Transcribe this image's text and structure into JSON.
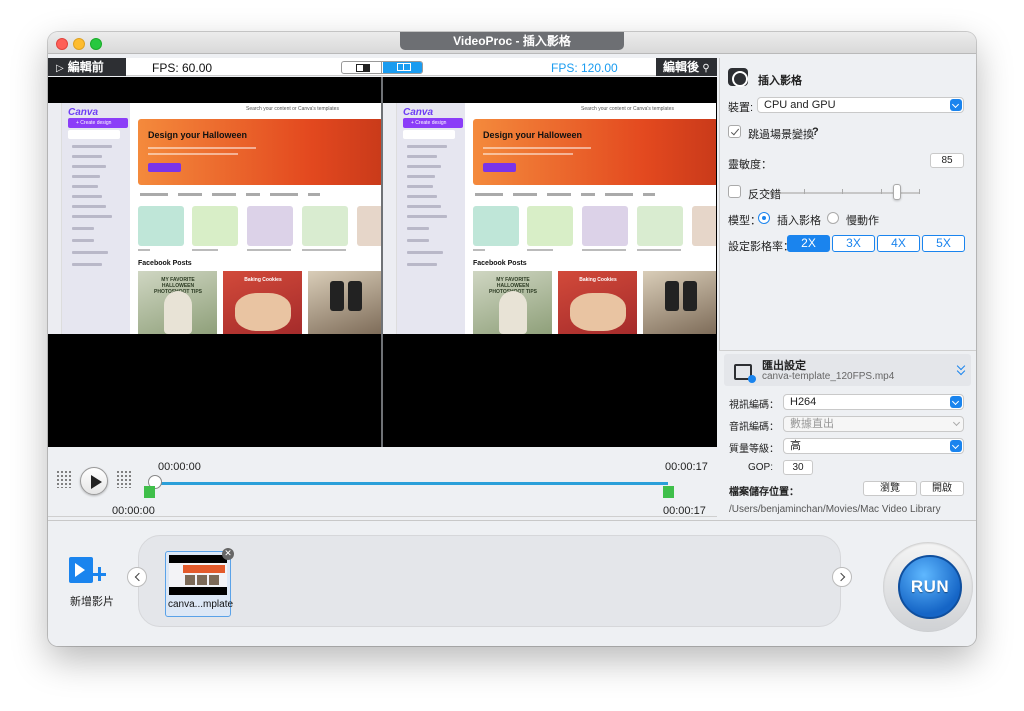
{
  "window": {
    "title": "VideoProc - 插入影格"
  },
  "preview": {
    "before_label": "編輯前",
    "fps_left": "FPS: 60.00",
    "fps_right": "FPS: 120.00",
    "after_label": "編輯後",
    "frame": {
      "logo": "Canva",
      "create_button": "+ Create design",
      "search_placeholder": "Search your content or Canva's templates",
      "banner_title": "Design your Halloween",
      "section_title": "Facebook Posts",
      "post_a_text": "MY FAVORITE HALLOWEEN PHOTOSHOOT TIPS",
      "post_b_text": "Baking Cookies"
    }
  },
  "playback": {
    "time_top_left": "00:00:00",
    "time_top_right": "00:00:17",
    "time_bottom_left": "00:00:00",
    "time_bottom_right": "00:00:17",
    "progress_fraction": 0.0
  },
  "settings": {
    "title": "插入影格",
    "device_label": "裝置:",
    "device_value": "CPU and GPU",
    "skip_scene_label": "跳過場景變換",
    "skip_scene_checked": true,
    "help": "?",
    "sensitivity_label": "靈敏度：",
    "sensitivity_value": "85",
    "sensitivity_fraction": 0.85,
    "deinterlace_label": "反交錯",
    "deinterlace_checked": false,
    "model_label": "模型：",
    "model_options": [
      "插入影格",
      "慢動作"
    ],
    "model_selected": "插入影格",
    "rate_label": "設定影格率：",
    "rates": [
      "2X",
      "3X",
      "4X",
      "5X"
    ],
    "rate_selected": "2X"
  },
  "export": {
    "title": "匯出設定",
    "filename": "canva-template_120FPS.mp4",
    "video_codec_label": "視訊編碼：",
    "video_codec_value": "H264",
    "audio_codec_label": "音訊編碼：",
    "audio_codec_value": "數據直出",
    "quality_label": "質量等級：",
    "quality_value": "高",
    "gop_label": "GOP:",
    "gop_value": "30",
    "save_location_label": "檔案儲存位置：",
    "browse_button": "瀏覽",
    "open_button": "開啟",
    "path": "/Users/benjaminchan/Movies/Mac Video Library"
  },
  "bottom": {
    "add_video_label": "新增影片",
    "clip_name": "canva...mplate",
    "run_button": "RUN"
  },
  "colors": {
    "accent": "#1a84ee",
    "track": "#2a9fd9",
    "marker": "#3fbf4a"
  }
}
